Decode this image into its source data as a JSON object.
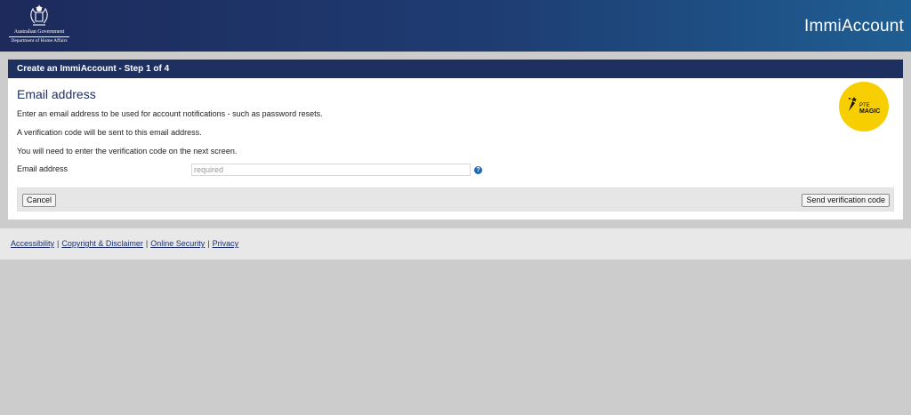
{
  "header": {
    "gov_line1": "Australian Government",
    "gov_line2": "Department of Home Affairs",
    "app_title": "ImmiAccount"
  },
  "form": {
    "step_title": "Create an ImmiAccount - Step 1 of 4",
    "heading": "Email address",
    "para1": "Enter an email address to be used for account notifications - such as password resets.",
    "para2": "A verification code will be sent to this email address.",
    "para3": "You will need to enter the verification code on the next screen.",
    "email_label": "Email address",
    "email_value": "",
    "email_placeholder": "required",
    "help_glyph": "?",
    "cancel_label": "Cancel",
    "send_label": "Send verification code"
  },
  "badge": {
    "line1": "PTE",
    "line2": "MAGIC"
  },
  "footer": {
    "links": [
      "Accessibility",
      "Copyright & Disclaimer",
      "Online Security",
      "Privacy"
    ],
    "separator": "|"
  },
  "colors": {
    "banner": "#1d2a5b",
    "step_bar": "#1d3060",
    "badge": "#f7cf00",
    "help_icon": "#1c6ab5"
  }
}
